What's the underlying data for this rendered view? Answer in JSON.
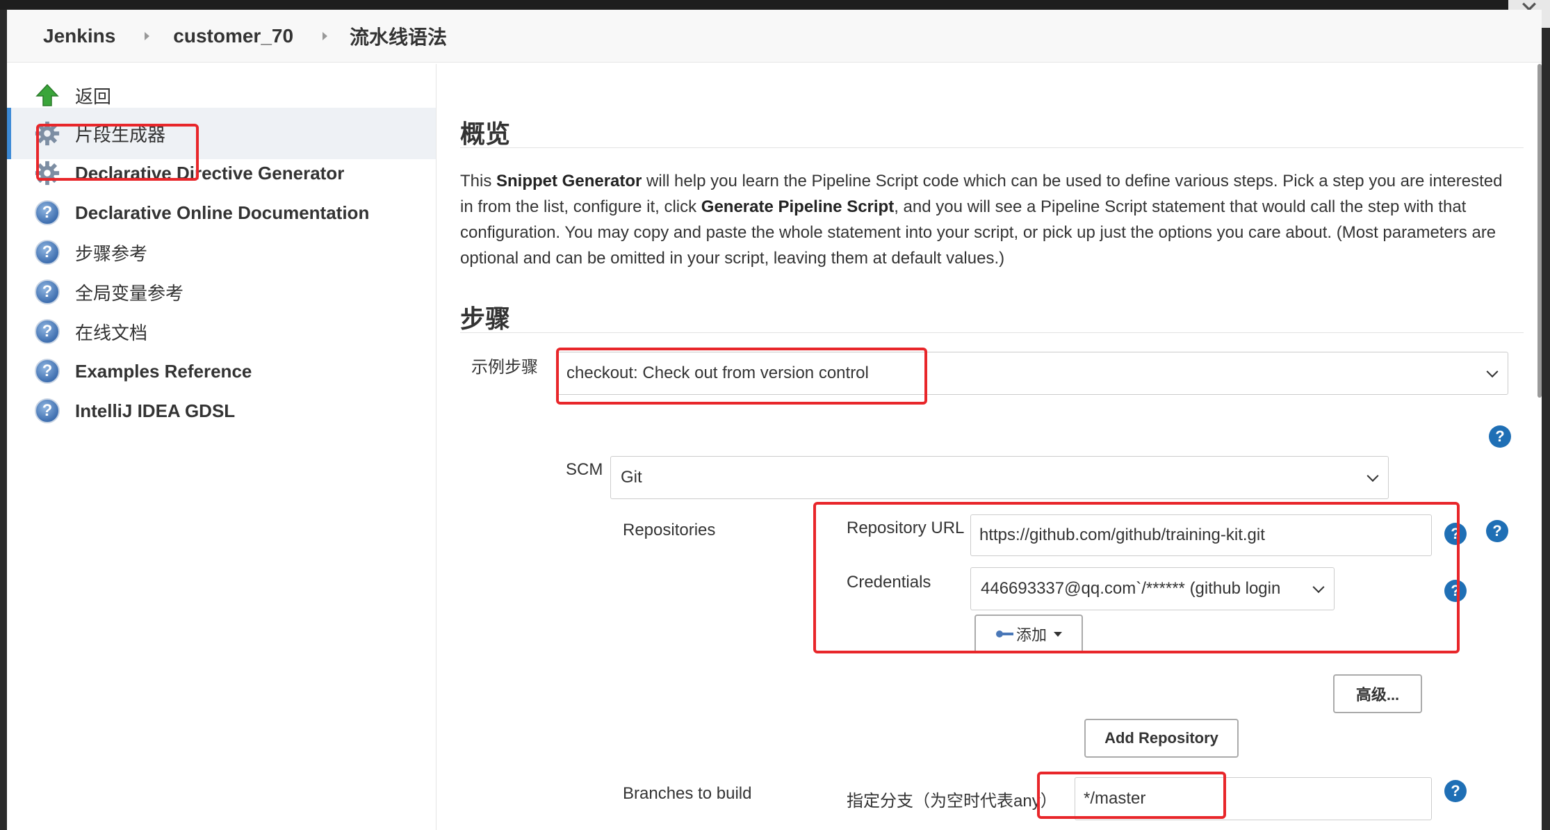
{
  "window": {
    "close_glyph": "✕"
  },
  "breadcrumb": [
    "Jenkins",
    "customer_70",
    "流水线语法"
  ],
  "sidebar": {
    "items": [
      {
        "label": "返回",
        "icon": "up-arrow-icon"
      },
      {
        "label": "片段生成器",
        "icon": "gear-icon",
        "active": true
      },
      {
        "label": "Declarative Directive Generator",
        "icon": "gear-icon"
      },
      {
        "label": "Declarative Online Documentation",
        "icon": "help-icon"
      },
      {
        "label": "步骤参考",
        "icon": "help-icon"
      },
      {
        "label": "全局变量参考",
        "icon": "help-icon"
      },
      {
        "label": "在线文档",
        "icon": "help-icon"
      },
      {
        "label": "Examples Reference",
        "icon": "help-icon"
      },
      {
        "label": "IntelliJ IDEA GDSL",
        "icon": "help-icon"
      }
    ]
  },
  "overview": {
    "heading": "概览",
    "text_1": "This ",
    "bold_1": "Snippet Generator",
    "text_2": " will help you learn the Pipeline Script code which can be used to define various steps. Pick a step you are interested in from the list, configure it, click ",
    "bold_2": "Generate Pipeline Script",
    "text_3": ", and you will see a Pipeline Script statement that would call the step with that configuration. You may copy and paste the whole statement into your script, or pick up just the options you care about. (Most parameters are optional and can be omitted in your script, leaving them at default values.)"
  },
  "steps": {
    "heading": "步骤",
    "sample_step_label": "示例步骤",
    "sample_step_value": "checkout: Check out from version control",
    "scm_label": "SCM",
    "scm_value": "Git",
    "repositories_label": "Repositories",
    "repo_url_label": "Repository URL",
    "repo_url_value": "https://github.com/github/training-kit.git",
    "credentials_label": "Credentials",
    "credentials_value": "446693337@qq.com`/****** (github login",
    "add_button": "添加",
    "advanced_button": "高级...",
    "add_repository_button": "Add Repository",
    "branches_label": "Branches to build",
    "branch_specifier_label": "指定分支（为空时代表any）",
    "branch_value": "*/master",
    "help_glyph": "?"
  },
  "colors": {
    "highlight": "#e8262a",
    "help": "#1f6fb5",
    "active_bar": "#3c8ad6"
  }
}
